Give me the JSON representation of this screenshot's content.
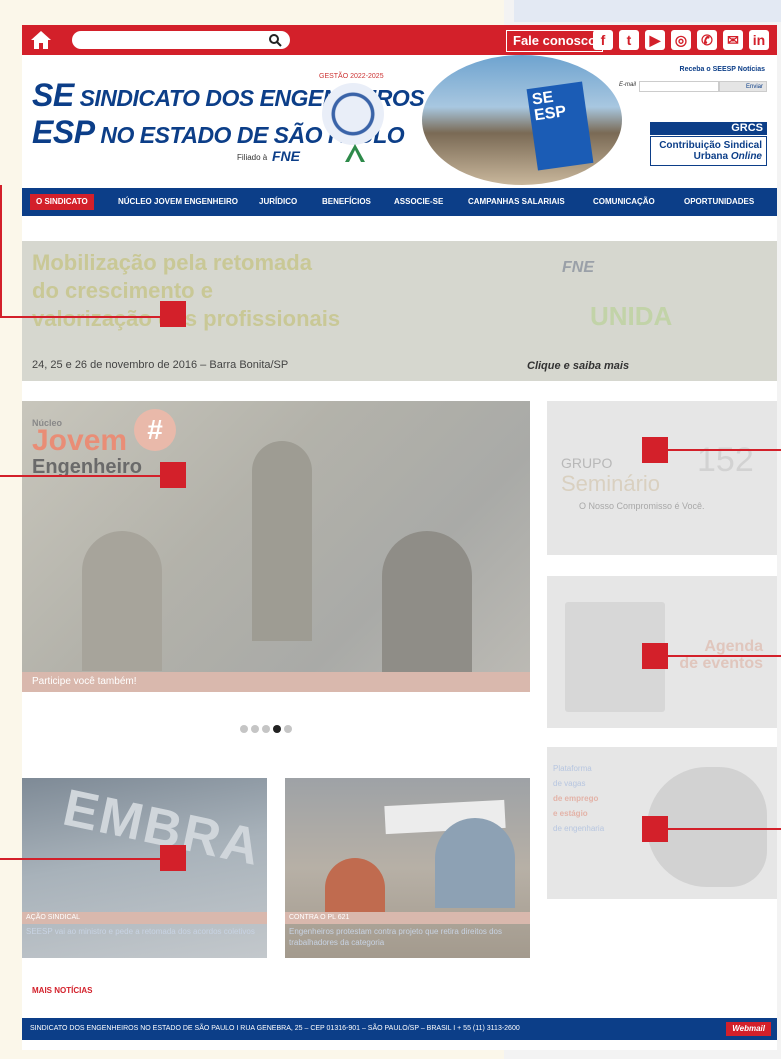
{
  "topbar": {
    "search_placeholder": "",
    "contact_label": "Fale conosco",
    "social": [
      "f",
      "t",
      "▶",
      "◎",
      "✆",
      "✉",
      "in"
    ]
  },
  "header": {
    "logo_line1_a": "SE",
    "logo_line1_b": "SINDICATO DOS ENGENHEIROS",
    "logo_line2_a": "ESP",
    "logo_line2_b": "NO ESTADO DE SÃO PAULO",
    "gestao": "GESTÃO 2022-2025",
    "filiado": "Filiado à",
    "fne": "FNE",
    "newsletter_title": "Receba o SEESP Notícias",
    "email_label": "E-mail",
    "send_label": "Enviar",
    "grcs_title": "GRCS",
    "grcs_line1": "Contribuição Sindical",
    "grcs_line2a": "Urbana",
    "grcs_line2b": "Online"
  },
  "nav": [
    "O SINDICATO",
    "NÚCLEO JOVEM ENGENHEIRO",
    "JURÍDICO",
    "BENEFÍCIOS",
    "ASSOCIE-SE",
    "CAMPANHAS SALARIAIS",
    "COMUNICAÇÃO",
    "OPORTUNIDADES"
  ],
  "banner": {
    "title_l1": "Mobilização pela retomada",
    "title_l2": "do crescimento e",
    "title_l3": "valorização dos profissionais",
    "date": "24, 25 e 26 de novembro de 2016 – Barra Bonita/SP",
    "cta": "Clique e saiba mais",
    "fne": "FNE",
    "unida": "UNIDA"
  },
  "hero": {
    "nucleo": "Núcleo",
    "jovem": "Jovem",
    "engenheiro": "Engenheiro",
    "caption": "Participe você também!",
    "slides": 5,
    "active_slide": 4
  },
  "news": [
    {
      "tag": "AÇÃO SINDICAL",
      "text": "SEESP vai ao ministro e pede a retomada dos acordos coletivos"
    },
    {
      "tag": "CONTRA O PL 621",
      "text": "Engenheiros protestam contra projeto que retira direitos dos trabalhadores da categoria"
    }
  ],
  "side": {
    "grupo": "GRUPO",
    "seminario": "Seminário",
    "compromisso": "O Nosso Compromisso é Você.",
    "agenda_l1": "Agenda",
    "agenda_l2": "de eventos",
    "vagas_l1": "Plataforma",
    "vagas_l2": "de vagas",
    "vagas_l3": "de emprego",
    "vagas_l4": "e estágio",
    "vagas_l5": "de engenharia"
  },
  "more_news": "MAIS NOTÍCIAS",
  "footer": {
    "address": "SINDICATO DOS ENGENHEIROS NO ESTADO DE SÃO PAULO I RUA GENEBRA, 25 – CEP 01316-901 – SÃO PAULO/SP – BRASIL I + 55 (11) 3113-2600",
    "webmail": "Webmail"
  }
}
